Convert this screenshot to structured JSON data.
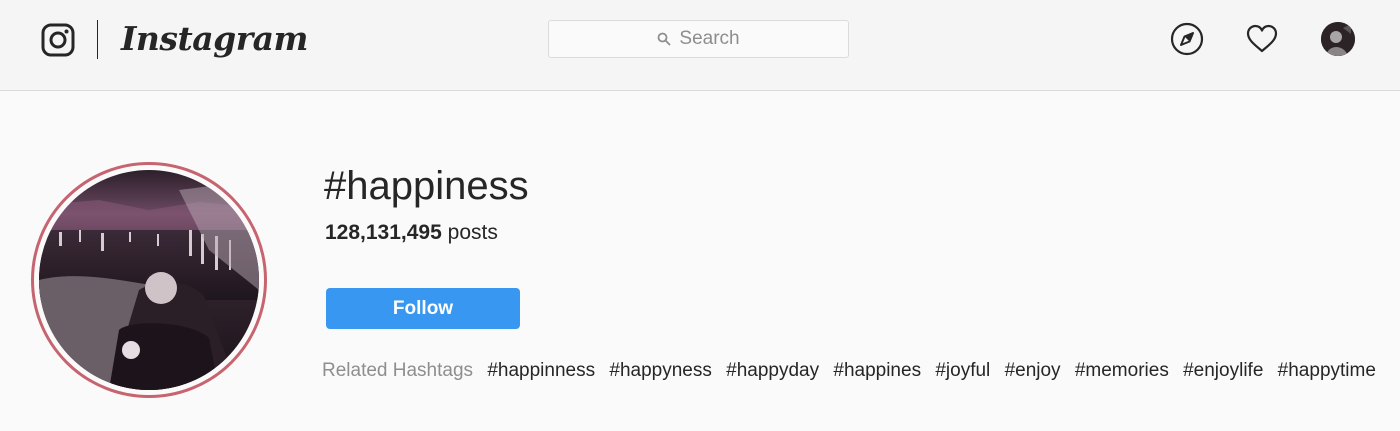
{
  "header": {
    "wordmark": "Instagram",
    "search": {
      "placeholder": "Search"
    },
    "icons": [
      "instagram-camera-icon",
      "compass-icon",
      "heart-icon",
      "user-avatar"
    ]
  },
  "hashtag_page": {
    "title": "#happiness",
    "post_count": "128,131,495",
    "post_label": "posts",
    "follow_label": "Follow",
    "related_label": "Related Hashtags",
    "related": [
      "#happinness",
      "#happyness",
      "#happyday",
      "#happines",
      "#joyful",
      "#enjoy",
      "#memories",
      "#enjoylife",
      "#happytime"
    ]
  },
  "colors": {
    "accent": "#3897f0",
    "ring": "#c6646f",
    "text": "#262626",
    "muted": "#8e8e8e",
    "border": "#dbdbdb"
  }
}
